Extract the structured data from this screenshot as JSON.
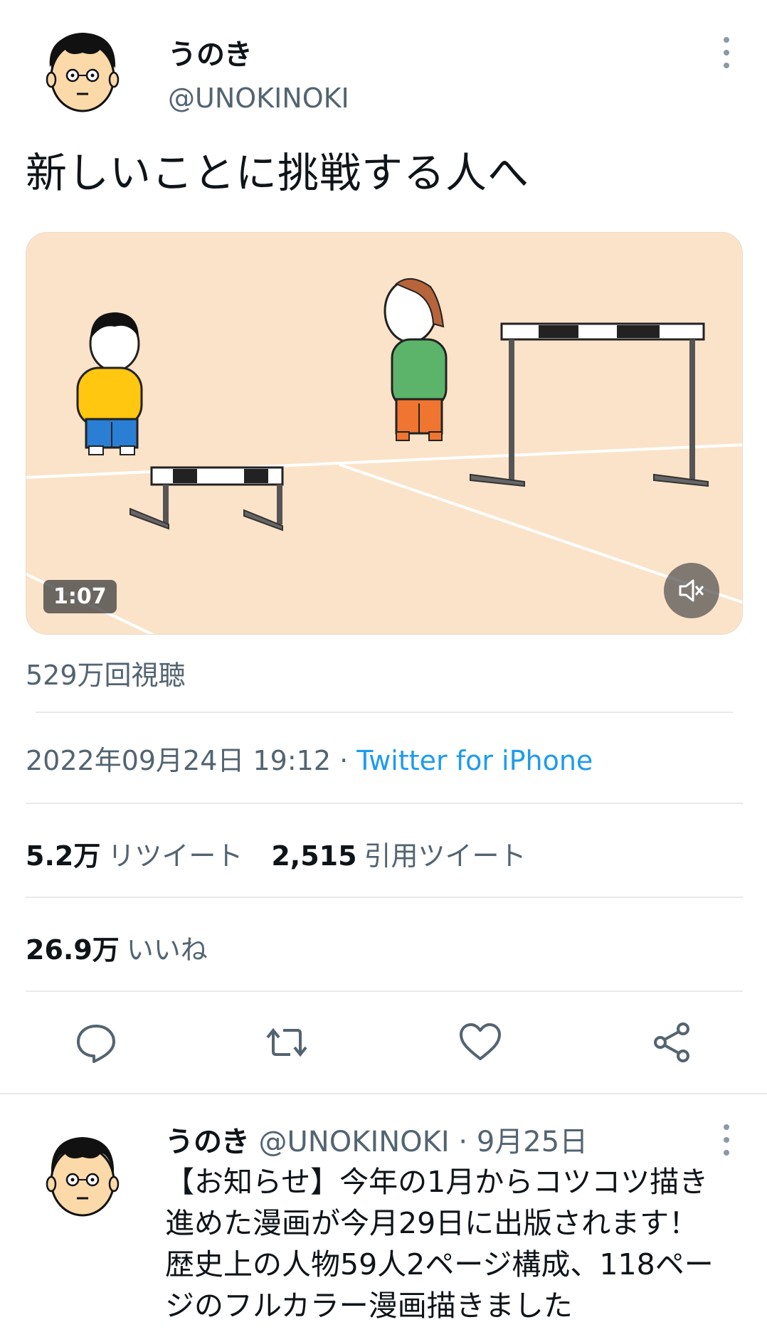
{
  "tweet": {
    "author_name": "うのき",
    "author_handle": "@UNOKINOKI",
    "text": "新しいことに挑戦する人へ",
    "media": {
      "duration": "1:07"
    },
    "views": "529万回視聴",
    "timestamp": "2022年09月24日 19:12",
    "separator": " · ",
    "source": "Twitter for iPhone",
    "retweets_count": "5.2万",
    "retweets_label": "リツイート",
    "quotes_count": "2,515",
    "quotes_label": "引用ツイート",
    "likes_count": "26.9万",
    "likes_label": "いいね"
  },
  "actions": [
    "reply-icon",
    "retweet-icon",
    "like-icon",
    "share-icon"
  ],
  "reply": {
    "author_name": "うのき",
    "author_handle": "@UNOKINOKI",
    "separator": " · ",
    "date": "9月25日",
    "text": "【お知らせ】今年の1月からコツコツ描き進めた漫画が今月29日に出版されます！歴史上の人物59人2ページ構成、118ページのフルカラー漫画描きました"
  },
  "colors": {
    "link": "#1d9bf0",
    "secondary_text": "#536471",
    "media_background": "#fbe3c9"
  }
}
